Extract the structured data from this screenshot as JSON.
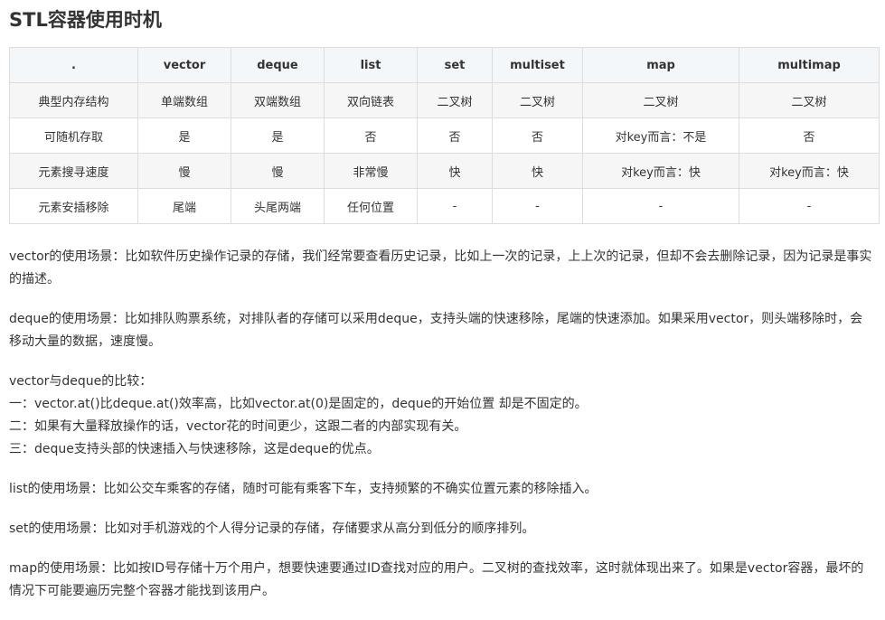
{
  "title": "STL容器使用时机",
  "table": {
    "headers": [
      ".",
      "vector",
      "deque",
      "list",
      "set",
      "multiset",
      "map",
      "multimap"
    ],
    "rows": [
      [
        "典型内存结构",
        "单端数组",
        "双端数组",
        "双向链表",
        "二叉树",
        "二叉树",
        "二叉树",
        "二叉树"
      ],
      [
        "可随机存取",
        "是",
        "是",
        "否",
        "否",
        "否",
        "对key而言：不是",
        "否"
      ],
      [
        "元素搜寻速度",
        "慢",
        "慢",
        "非常慢",
        "快",
        "快",
        "对key而言：快",
        "对key而言：快"
      ],
      [
        "元素安插移除",
        "尾端",
        "头尾两端",
        "任何位置",
        "-",
        "-",
        "-",
        "-"
      ]
    ]
  },
  "paragraphs": {
    "vector_usage": "vector的使用场景：比如软件历史操作记录的存储，我们经常要查看历史记录，比如上一次的记录，上上次的记录，但却不会去删除记录，因为记录是事实的描述。",
    "deque_usage": "deque的使用场景：比如排队购票系统，对排队者的存储可以采用deque，支持头端的快速移除，尾端的快速添加。如果采用vector，则头端移除时，会移动大量的数据，速度慢。",
    "compare_title": "vector与deque的比较：",
    "compare_1": "一：vector.at()比deque.at()效率高，比如vector.at(0)是固定的，deque的开始位置 却是不固定的。",
    "compare_2": "二：如果有大量释放操作的话，vector花的时间更少，这跟二者的内部实现有关。",
    "compare_3": "三：deque支持头部的快速插入与快速移除，这是deque的优点。",
    "list_usage": "list的使用场景：比如公交车乘客的存储，随时可能有乘客下车，支持频繁的不确实位置元素的移除插入。",
    "set_usage": "set的使用场景：比如对手机游戏的个人得分记录的存储，存储要求从高分到低分的顺序排列。",
    "map_usage": "map的使用场景：比如按ID号存储十万个用户，想要快速要通过ID查找对应的用户。二叉树的查找效率，这时就体现出来了。如果是vector容器，最坏的情况下可能要遍历完整个容器才能找到该用户。"
  }
}
